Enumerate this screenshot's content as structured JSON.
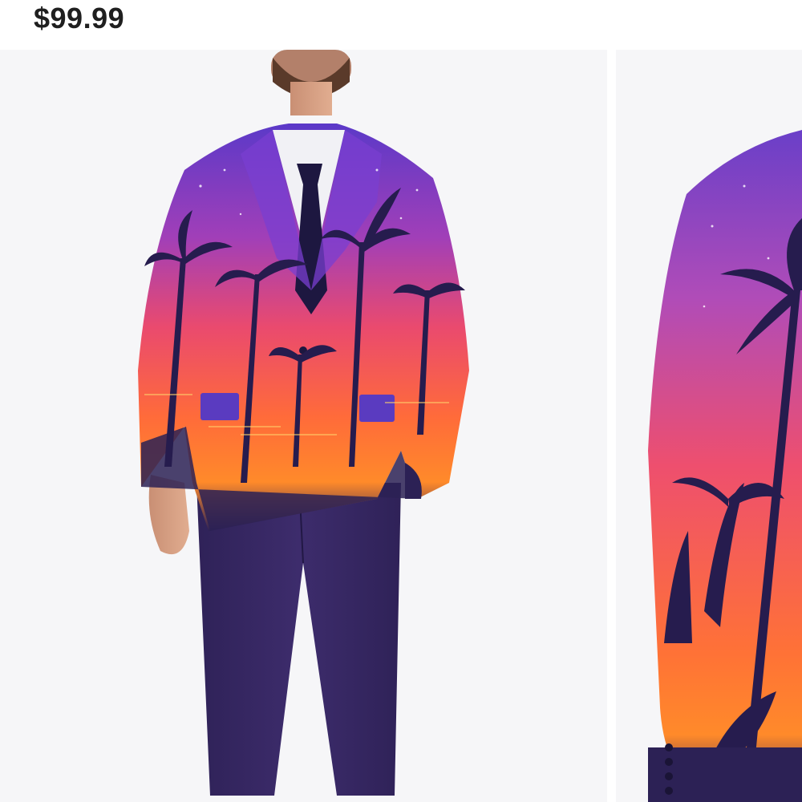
{
  "product": {
    "price": "$99.99"
  },
  "gallery": {
    "images": [
      {
        "alt_icon": "product-photo-full-suit"
      },
      {
        "alt_icon": "product-photo-sleeve-detail"
      }
    ]
  },
  "colors": {
    "background": "#f6f6f8",
    "price_text": "#1f1f1f",
    "suit_navy": "#2c2155",
    "pants": "#3a2a66",
    "gradient_top": "#6a3fc8",
    "gradient_mid": "#e8496e",
    "gradient_bottom": "#ff7a2a"
  }
}
